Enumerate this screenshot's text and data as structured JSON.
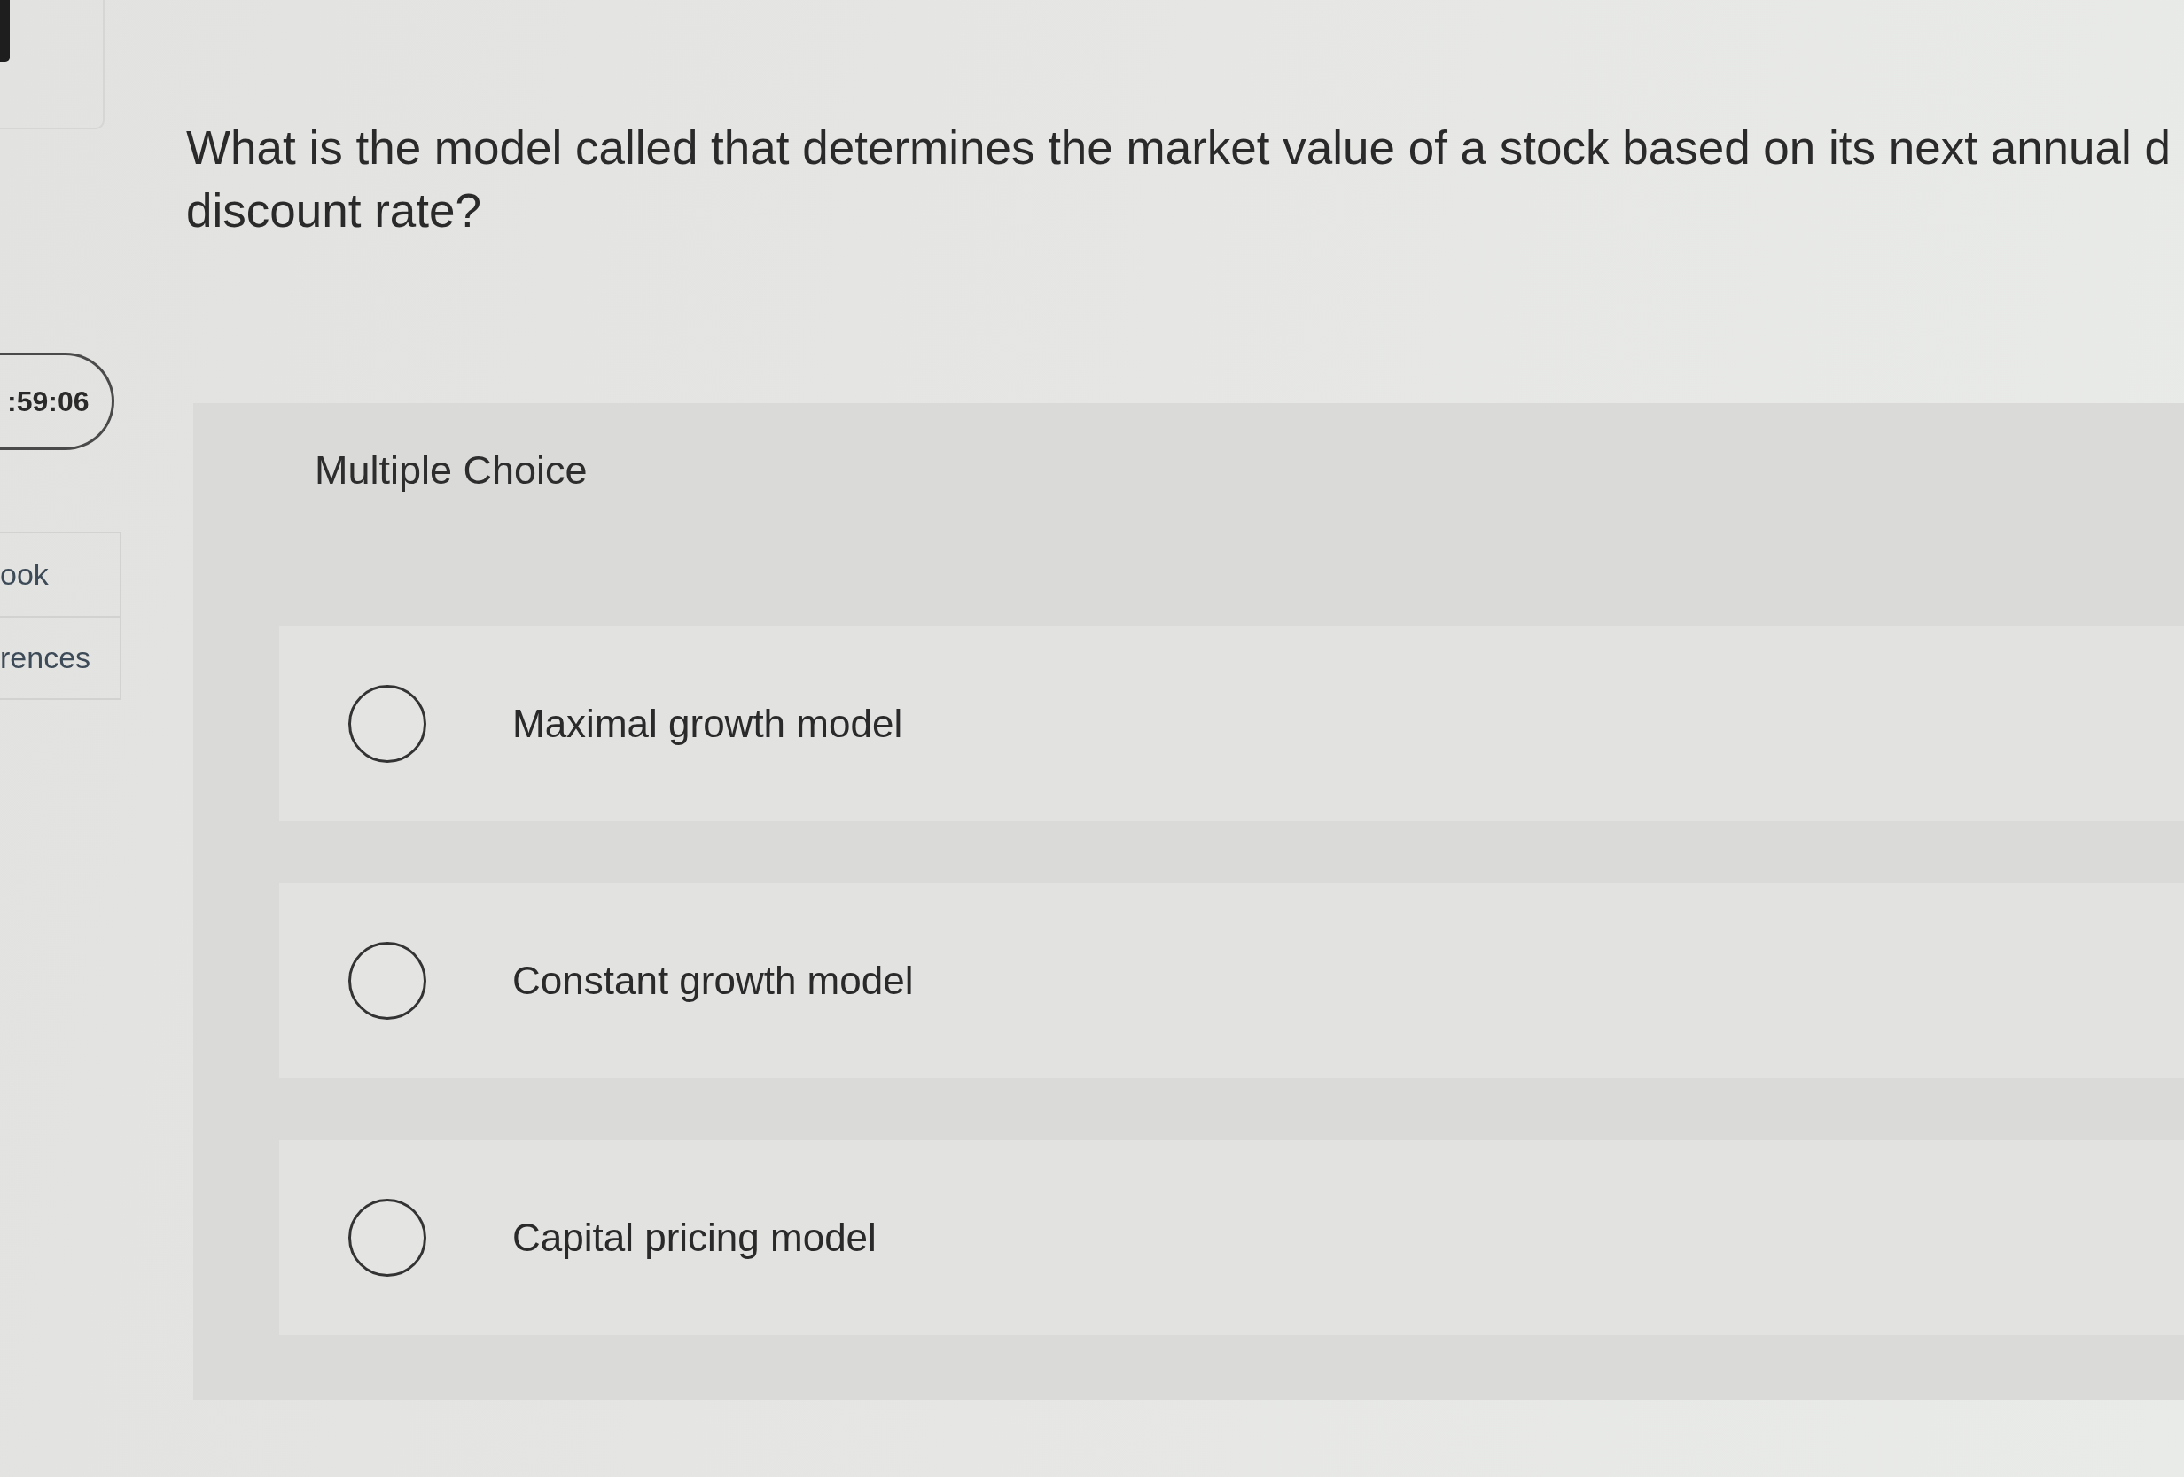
{
  "sidebar": {
    "timer": ":59:06",
    "links": [
      "ook",
      "rences"
    ]
  },
  "question": {
    "lines": [
      "What is the model called that determines the market value of a stock based on its next annual d",
      "discount rate?"
    ]
  },
  "answer_panel": {
    "heading": "Multiple Choice",
    "options": [
      {
        "label": "Maximal growth model",
        "selected": false
      },
      {
        "label": "Constant growth model",
        "selected": false
      },
      {
        "label": "Capital pricing model",
        "selected": false
      }
    ]
  }
}
